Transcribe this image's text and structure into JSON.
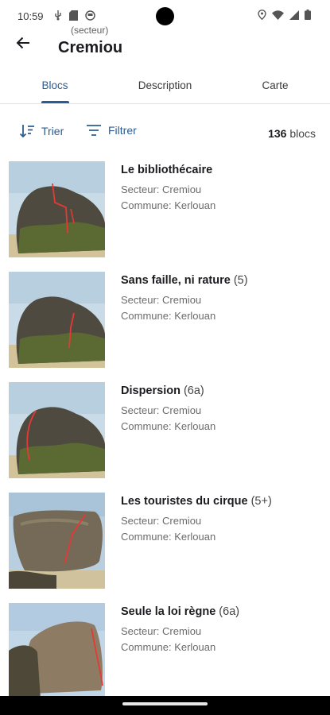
{
  "status": {
    "time": "10:59"
  },
  "header": {
    "subtitle": "(secteur)",
    "title": "Cremiou"
  },
  "tabs": [
    {
      "label": "Blocs",
      "active": true
    },
    {
      "label": "Description",
      "active": false
    },
    {
      "label": "Carte",
      "active": false
    }
  ],
  "toolbar": {
    "sort_label": "Trier",
    "filter_label": "Filtrer",
    "count_number": "136",
    "count_unit": "blocs"
  },
  "items": [
    {
      "name": "Le bibliothécaire",
      "grade": "",
      "sector": "Secteur: Cremiou",
      "commune": "Commune: Kerlouan"
    },
    {
      "name": "Sans faille, ni rature",
      "grade": "(5)",
      "sector": "Secteur: Cremiou",
      "commune": "Commune: Kerlouan"
    },
    {
      "name": "Dispersion",
      "grade": "(6a)",
      "sector": "Secteur: Cremiou",
      "commune": "Commune: Kerlouan"
    },
    {
      "name": "Les touristes du cirque",
      "grade": "(5+)",
      "sector": "Secteur: Cremiou",
      "commune": "Commune: Kerlouan"
    },
    {
      "name": "Seule la loi règne",
      "grade": "(6a)",
      "sector": "Secteur: Cremiou",
      "commune": "Commune: Kerlouan"
    }
  ],
  "colors": {
    "accent": "#2b5c93",
    "route_line": "#e53935"
  }
}
